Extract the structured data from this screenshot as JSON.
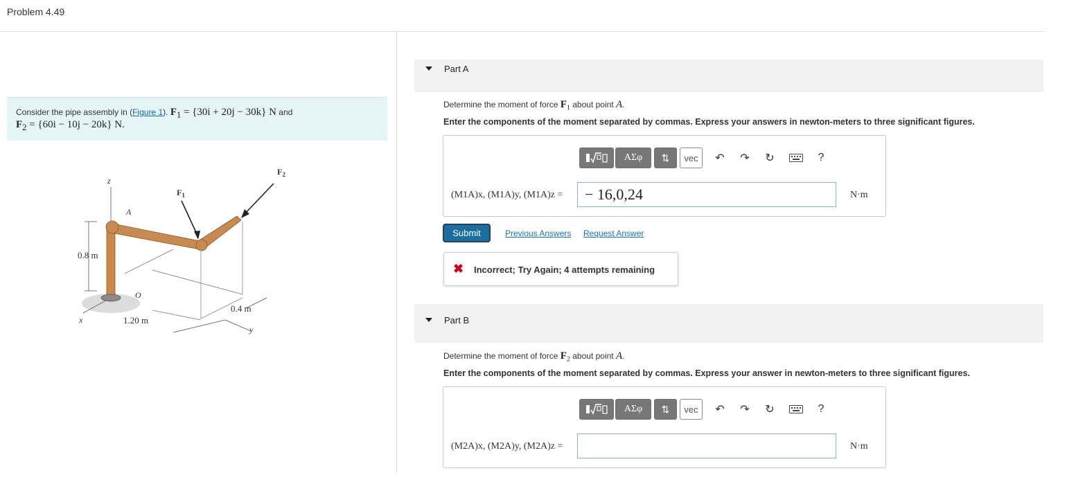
{
  "header": {
    "title": "Problem 4.49"
  },
  "problem": {
    "intro": "Consider the pipe assembly in (",
    "figure_link": "Figure 1",
    "intro_end": ").",
    "f1_label": "F",
    "f1_sub": "1",
    "f1_value": " = {30i + 20j − 30k} N",
    "and": " and",
    "f2_label": "F",
    "f2_sub": "2",
    "f2_value": " = {60i − 10j − 20k} N."
  },
  "figure": {
    "label_z": "z",
    "label_a": "A",
    "label_o": "O",
    "label_x": "x",
    "label_y": "y",
    "label_f1": "F",
    "label_f1_sub": "1",
    "label_f2": "F",
    "label_f2_sub": "2",
    "dim_height": "0.8 m",
    "dim_length": "1.20 m",
    "dim_offset": "0.4 m"
  },
  "part_a": {
    "label": "Part A",
    "description_pre": "Determine the moment of force ",
    "description_force": "F",
    "description_force_sub": "1",
    "description_post": " about point ",
    "description_point": "A",
    "description_end": ".",
    "instructions": "Enter the components of the moment separated by commas. Express your answers in newton-meters to three significant figures.",
    "answer_label": "(M1A)x, (M1A)y, (M1A)z =",
    "answer_value": "− 16,0,24",
    "unit": "N·m",
    "submit": "Submit",
    "previous_answers": "Previous Answers",
    "request_answer": "Request Answer",
    "feedback": "Incorrect; Try Again; 4 attempts remaining"
  },
  "part_b": {
    "label": "Part B",
    "description_pre": "Determine the moment of force ",
    "description_force": "F",
    "description_force_sub": "2",
    "description_post": " about point ",
    "description_point": "A",
    "description_end": ".",
    "instructions": "Enter the components of the moment separated by commas. Express your answer in newton-meters to three significant figures.",
    "answer_label": "(M2A)x, (M2A)y, (M2A)z =",
    "answer_value": "",
    "unit": "N·m"
  },
  "toolbar": {
    "templates_icon": "sqrt-template-icon",
    "greek": "ΑΣφ",
    "sort_icon": "up-down-arrows-icon",
    "vec": "vec",
    "undo_icon": "undo-icon",
    "redo_icon": "redo-icon",
    "reset_icon": "reset-icon",
    "keyboard_icon": "keyboard-icon",
    "help": "?"
  },
  "colors": {
    "problem_bg": "#e5f5f7",
    "submit_bg": "#1b6fa0",
    "link": "#1574b3",
    "error": "#d0021b",
    "pipe": "#c88a4e"
  }
}
